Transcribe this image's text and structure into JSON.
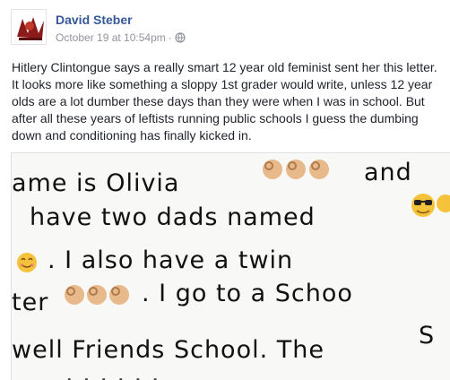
{
  "post": {
    "author": "David Steber",
    "timestamp": "October 19 at 10:54pm",
    "separator": "·",
    "privacy_icon": "globe-icon",
    "text": "Hitlery Clintongue says a really smart 12 year old feminist sent her this letter. It looks more like something a sloppy 1st grader would write, unless 12 year olds are a lot dumber these days than they were when I was in school. But after all these years of leftists running public schools I guess the dumbing down and conditioning has finally kicked in."
  },
  "letter": {
    "line1": "ame is Olivia",
    "line1_tail": "and",
    "line2": "have two dads named",
    "line3": ". I also have a twin",
    "line4_start": "ter",
    "line4_rest": ". I go to a Schoo",
    "line5": "well Friends School. The",
    "line5_tail": "S"
  },
  "colors": {
    "link": "#365899",
    "meta": "#90949c",
    "text": "#1d2129"
  }
}
